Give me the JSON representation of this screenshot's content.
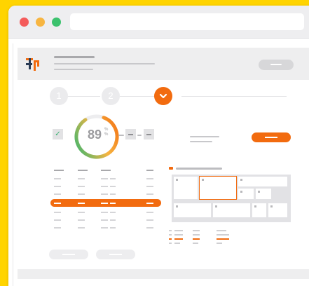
{
  "window": {
    "controls": [
      "close",
      "minimize",
      "maximize"
    ]
  },
  "stepper": {
    "steps": [
      {
        "label": "1",
        "state": "upcoming"
      },
      {
        "label": "2",
        "state": "upcoming"
      },
      {
        "label": "",
        "state": "active",
        "icon": "chevron-down-icon"
      }
    ]
  },
  "score": {
    "value": "89",
    "unit_top": "%",
    "unit_bottom": "%",
    "fill_fraction": 0.85
  },
  "colors": {
    "accent": "#F26B0F",
    "success": "#3BB273",
    "gauge_start": "#F26B0F",
    "gauge_end": "#2BB673"
  }
}
